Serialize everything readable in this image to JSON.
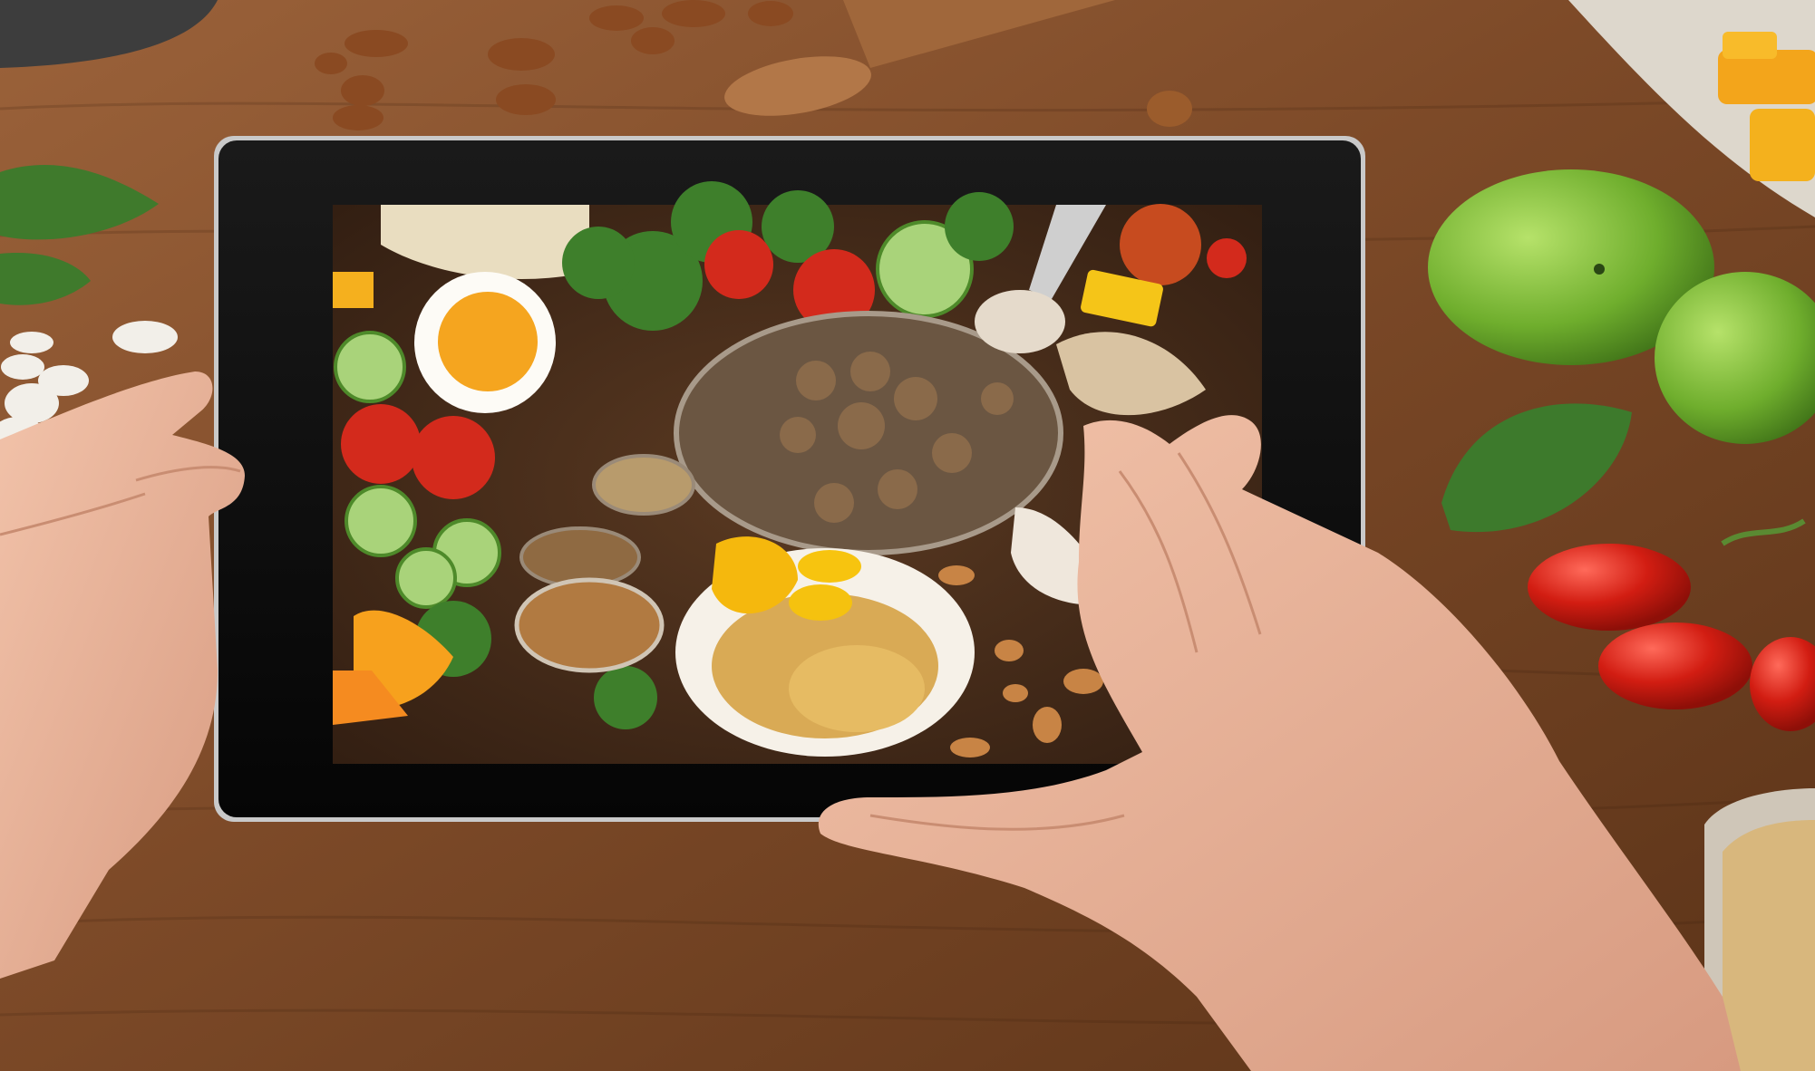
{
  "scene": {
    "description": "",
    "colors": {
      "table_light": "#9a6038",
      "table_dark": "#5e3619",
      "tablet_bezel": "#0c0c0c",
      "skin": "#e9b69c",
      "skin_shadow": "#c98d72",
      "apple_green": "#78b52f",
      "tomato_red": "#cf1f16",
      "leaf_green": "#3d7a2c",
      "squash_orange": "#f2a21c",
      "nut_brown": "#8a4a22"
    },
    "icons": [
      "tablet-icon",
      "apple-icon",
      "tomato-icon",
      "leaf-icon",
      "spoon-icon",
      "bowl-icon",
      "nut-icon",
      "hand-icon"
    ]
  }
}
